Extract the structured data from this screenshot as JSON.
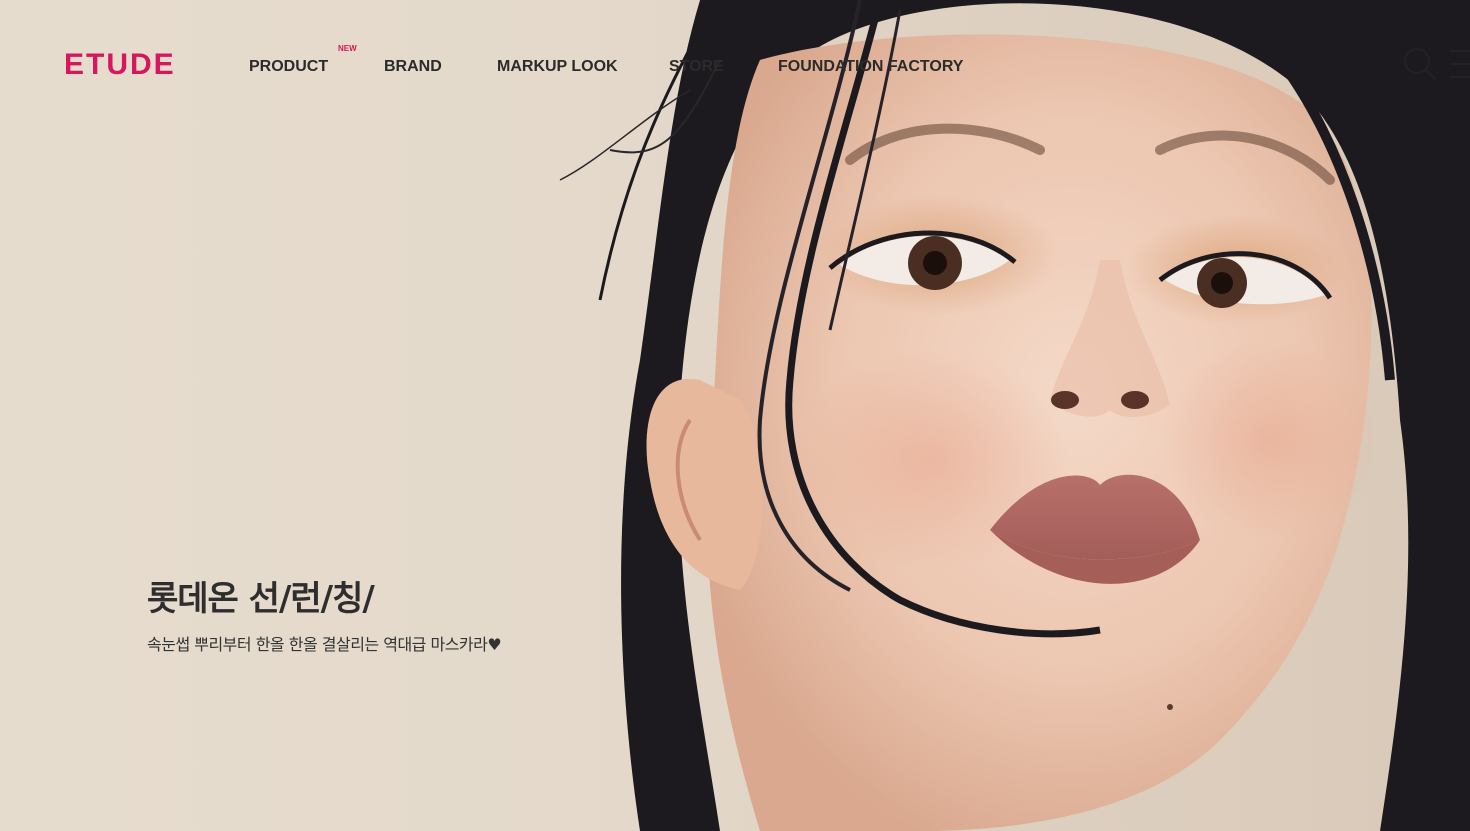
{
  "brand": {
    "logo_text": "ETUDE",
    "accent_color": "#d6175d"
  },
  "nav": {
    "items": [
      {
        "label": "PRODUCT",
        "badge": "NEW"
      },
      {
        "label": "BRAND"
      },
      {
        "label": "MARKUP LOOK"
      },
      {
        "label": "STORE"
      },
      {
        "label": "FOUNDATION FACTORY"
      }
    ]
  },
  "header_icons": {
    "search": "search-icon",
    "menu": "hamburger-menu-icon"
  },
  "hero": {
    "title": "롯데온 선/런/칭/",
    "subtitle": "속눈썹 뿌리부터 한올 한올 결살리는 역대급 마스카라♥"
  }
}
